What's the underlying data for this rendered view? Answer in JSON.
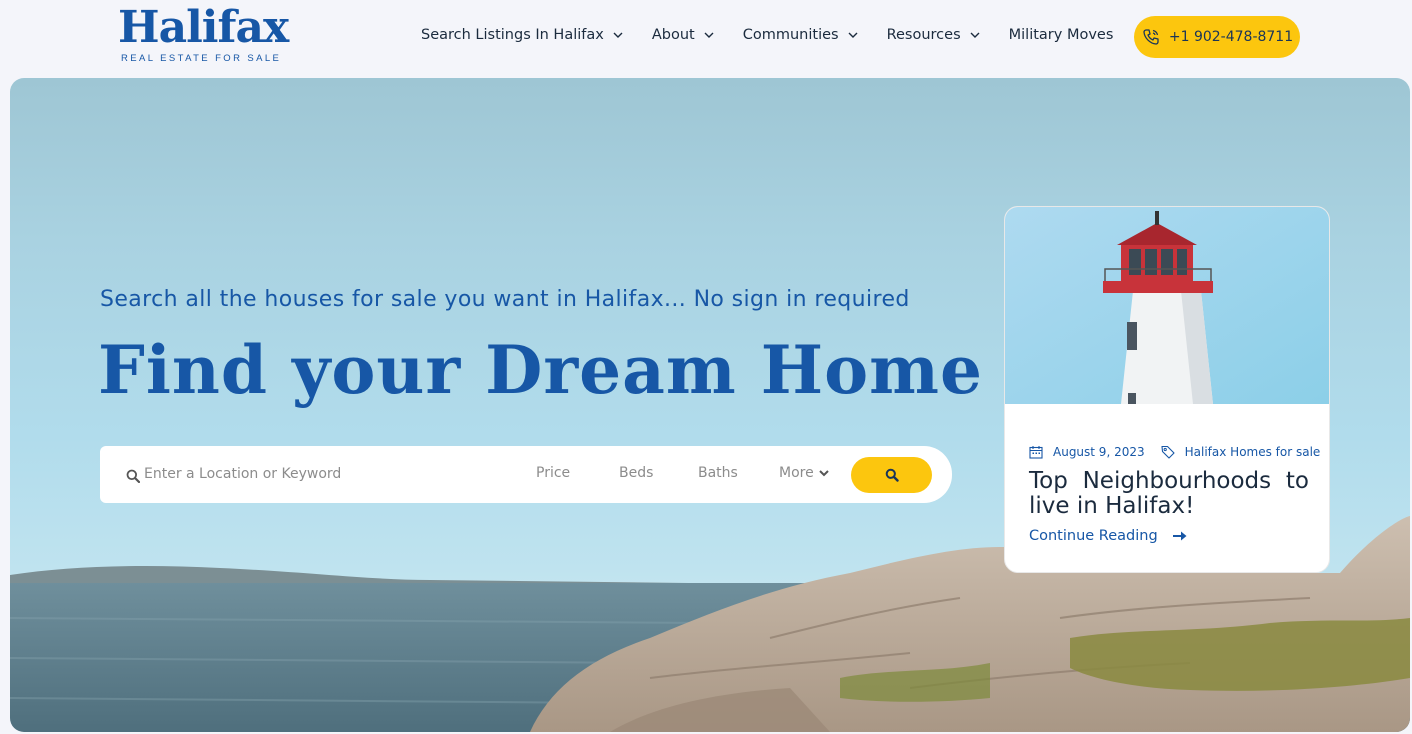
{
  "brand": {
    "name": "Halifax",
    "tagline": "REAL ESTATE FOR SALE",
    "primary_color": "#1757a6",
    "accent_color": "#fcc60e"
  },
  "nav": {
    "items": [
      {
        "label": "Search Listings In Halifax",
        "has_dropdown": true
      },
      {
        "label": "About",
        "has_dropdown": true
      },
      {
        "label": "Communities",
        "has_dropdown": true
      },
      {
        "label": "Resources",
        "has_dropdown": true
      },
      {
        "label": "Military Moves",
        "has_dropdown": false
      }
    ],
    "phone": {
      "label": "+1 902-478-8711",
      "icon": "phone-icon"
    }
  },
  "hero": {
    "subheading": "Search all the houses for sale you want in Halifax... No sign in required",
    "heading": "Find your Dream Home"
  },
  "search": {
    "placeholder": "Enter a Location or Keyword",
    "filters": {
      "price": "Price",
      "beds": "Beds",
      "baths": "Baths",
      "more": "More"
    },
    "icons": {
      "field": "search-icon",
      "button": "search-icon",
      "more": "chevron-down-icon"
    }
  },
  "featured_post": {
    "date": "August 9, 2023",
    "category": "Halifax Homes for sale",
    "title": "Top Neighbourhoods to live in Halifax!",
    "link_label": "Continue Reading",
    "icons": {
      "date": "calendar-icon",
      "category": "tag-icon",
      "link": "arrow-right-icon"
    }
  }
}
